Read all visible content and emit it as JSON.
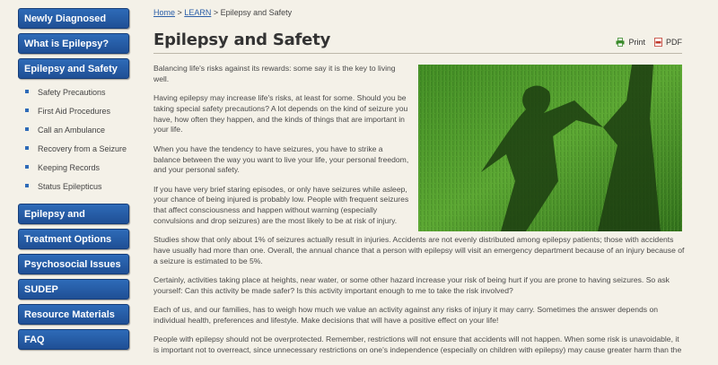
{
  "sidebar": {
    "main_items": [
      {
        "label": "Newly Diagnosed"
      },
      {
        "label": "What is Epilepsy?"
      },
      {
        "label": "Epilepsy and Safety"
      }
    ],
    "sub_items": [
      {
        "label": "Safety Precautions"
      },
      {
        "label": "First Aid Procedures"
      },
      {
        "label": "Call an Ambulance"
      },
      {
        "label": "Recovery from a Seizure"
      },
      {
        "label": "Keeping Records"
      },
      {
        "label": "Status Epilepticus"
      }
    ],
    "more_items": [
      {
        "label": "Epilepsy and Learning"
      },
      {
        "label": "Treatment Options"
      },
      {
        "label": "Psychosocial Issues"
      },
      {
        "label": "SUDEP"
      },
      {
        "label": "Resource Materials"
      },
      {
        "label": "FAQ"
      }
    ]
  },
  "breadcrumb": {
    "home": "Home",
    "sep": ">",
    "learn": "LEARN",
    "current": "Epilepsy and Safety"
  },
  "page": {
    "title": "Epilepsy and Safety"
  },
  "tools": {
    "print": "Print",
    "pdf": "PDF"
  },
  "content": {
    "p1": "Balancing life's risks against its rewards: some say it is the key to living well.",
    "p2": "Having epilepsy may increase life's risks, at least for some. Should you be taking special safety precautions? A lot depends on the kind of seizure you have, how often they happen, and the kinds of things that are important in your life.",
    "p3": "When you have the tendency to have seizures, you have to strike a balance between the way you want to live your life, your personal freedom, and your personal safety.",
    "p4": "If you have very brief staring episodes, or only have seizures while asleep, your chance of being injured is probably low. People with frequent seizures that affect consciousness and happen without warning (especially convulsions and drop seizures) are the most likely to be at risk of injury.",
    "p5": "Studies show that only about 1% of seizures actually result in injuries. Accidents are not evenly distributed among epilepsy patients; those with accidents have usually had more than one. Overall, the annual chance that a person with epilepsy will visit an emergency department because of an injury because of a seizure is estimated to be 5%.",
    "p6": "Certainly, activities taking place at heights, near water, or some other hazard increase your risk of being hurt if you are prone to having seizures. So ask yourself: Can this activity be made safer? Is this activity important enough to me to take the risk involved?",
    "p7": "Each of us, and our families, has to weigh how much we value an activity against any risks of injury it may carry. Sometimes the answer depends on individual health, preferences and lifestyle. Make decisions that will have a positive effect on your life!",
    "p8": "People with epilepsy should not be overprotected. Remember, restrictions will not ensure that accidents will not happen. When some risk is unavoidable, it is important not to overreact, since unnecessary restrictions on one's independence (especially on children with epilepsy) may cause greater harm than the"
  },
  "colors": {
    "nav_blue": "#2e6bb8",
    "link": "#2b5fa8",
    "background": "#f4f1e8",
    "grass": "#4e9a2a"
  },
  "icons": {
    "print": "printer-icon",
    "pdf": "pdf-icon"
  }
}
